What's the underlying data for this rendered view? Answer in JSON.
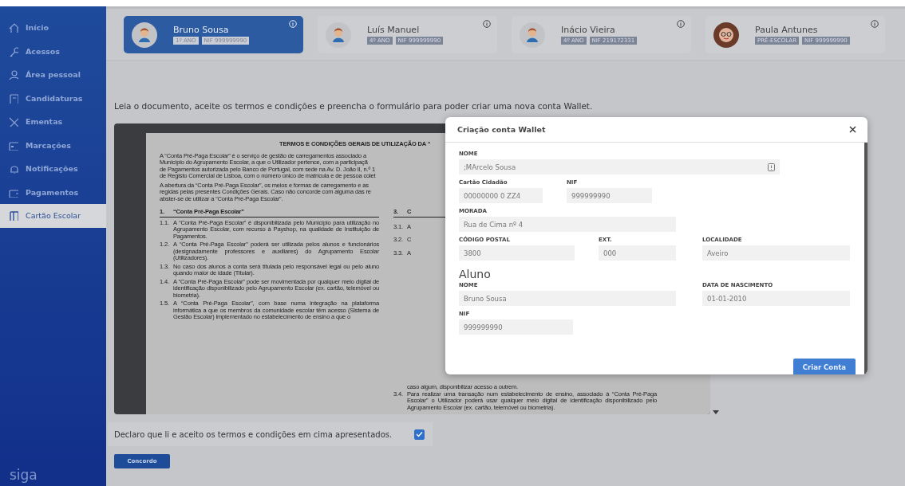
{
  "sidebar": {
    "items": [
      {
        "label": "Início",
        "selected": false
      },
      {
        "label": "Acessos",
        "selected": false
      },
      {
        "label": "Área pessoal",
        "selected": false
      },
      {
        "label": "Candidaturas",
        "selected": false
      },
      {
        "label": "Ementas",
        "selected": false
      },
      {
        "label": "Marcações",
        "selected": false
      },
      {
        "label": "Notificações",
        "selected": false
      },
      {
        "label": "Pagamentos",
        "selected": false
      },
      {
        "label": "Cartão Escolar",
        "selected": true
      }
    ],
    "logo": "siga"
  },
  "students": [
    {
      "name": "Bruno Sousa",
      "year": "1º ANO",
      "nif": "NIF 999999990",
      "kind": "boy",
      "selected": true
    },
    {
      "name": "Luís Manuel",
      "year": "4º ANO",
      "nif": "NIF 999999990",
      "kind": "boy",
      "selected": false
    },
    {
      "name": "Inácio Vieira",
      "year": "4º ANO",
      "nif": "NIF 219172331",
      "kind": "boy",
      "selected": false
    },
    {
      "name": "Paula Antunes",
      "year": "PRÉ-ESCOLAR",
      "nif": "NIF 999999990",
      "kind": "girl",
      "selected": false
    }
  ],
  "instruction": "Leia o documento, aceite os termos e condições e preencha o formulário para poder criar uma nova conta Wallet.",
  "document": {
    "title": "TERMOS E CONDIÇÕES GERAIS DE UTILIZAÇÃO DA “",
    "intro": [
      [
        "A “Conta Pré-Paga Escolar” é o serviço de gestão de carregamentos associado a",
        "Município do Agrupamento Escolar, a que o Utilizador pertence, com a participaçã",
        "de Pagamentos autorizada pelo Banco de Portugal, com sede na Av. D. João II, n.º 1",
        "de Registo Comercial de Lisboa, com o número único de matrícula e de pessoa colet"
      ],
      [
        "A abertura da “Conta Pré-Paga Escolar”, os meios e formas de carregamento e as",
        "regidas pelas presentes Condições Gerais. Caso não concorde com alguma das re",
        "abster-se de utilizar a “Conta Pré-Paga Escolar”."
      ]
    ],
    "column_1": {
      "heading": {
        "num": "1.",
        "text": "“Conta Pré-Paga Escolar”"
      },
      "items": [
        {
          "num": "1.1.",
          "text": "A “Conta Pré-Paga Escolar” é disponibilizada pelo Município para utilização no Agrupamento Escolar, com recurso à Payshop, na qualidade de Instituição de Pagamentos."
        },
        {
          "num": "1.2.",
          "text": "A “Conta Pré-Paga Escolar” poderá ser utilizada pelos alunos e funcionários (designadamente professores e auxiliares) do Agrupamento Escolar (Utilizadores)."
        },
        {
          "num": "1.3.",
          "text": "No caso dos alunos a conta será titulada pelo responsável legal ou pelo aluno quando maior de idade (Titular)."
        },
        {
          "num": "1.4.",
          "text": "A “Conta Pré-Paga Escolar” pode ser movimentada por qualquer meio digital de identificação disponibilizado pelo Agrupamento Escolar (ex. cartão, telemóvel ou biometria)."
        },
        {
          "num": "1.5.",
          "text": "A “Conta Pré-Paga Escolar”, com base numa integração na plataforma informática a que os membros da comunidade escolar têm acesso (Sistema de Gestão Escolar) implementado no estabelecimento de ensino a que o"
        }
      ]
    },
    "column_2": {
      "heading": {
        "num": "3.",
        "text": "C"
      },
      "items": [
        {
          "num": "3.1.",
          "text": "A"
        },
        {
          "num": "3.2.",
          "text": "C"
        },
        {
          "num": "3.3.",
          "text": "A"
        },
        {
          "text": "caso algum, disponibilizar acesso a outrem."
        },
        {
          "num": "3.4.",
          "text": "Para realizar uma transação num estabelecimento de ensino, associado à “Conta Pré-Paga Escolar” o Utilizador poderá usar qualquer meio digital de identificação disponibilizado pelo Agrupamento Escolar (ex. cartão, telemóvel ou biometria)."
        }
      ]
    }
  },
  "agreement": {
    "label": "Declaro que li e aceito os termos e condições em cima apresentados.",
    "checked": true
  },
  "agree_button": "Concordo",
  "modal": {
    "title": "Criação conta Wallet",
    "fields": [
      {
        "label": "NOME",
        "value": ";MArcelo Sousa"
      },
      {
        "label": "Cartão Cidadão",
        "value": "00000000 0 ZZ4"
      },
      {
        "label": "NIF",
        "value": "999999990"
      },
      {
        "label": "MORADA",
        "value": "Rua de Cima nº 4"
      },
      {
        "label": "CÓDIGO POSTAL",
        "value": "3800"
      },
      {
        "label": "EXT.",
        "value": "000"
      },
      {
        "label": "LOCALIDADE",
        "value": "Aveiro"
      }
    ],
    "section": "Aluno",
    "student_fields": [
      {
        "label": "NOME",
        "value": "Bruno Sousa"
      },
      {
        "label": "DATA DE NASCIMENTO",
        "value": "01-01-2010"
      },
      {
        "label": "NIF",
        "value": "999999990"
      }
    ],
    "submit": "Criar Conta"
  }
}
